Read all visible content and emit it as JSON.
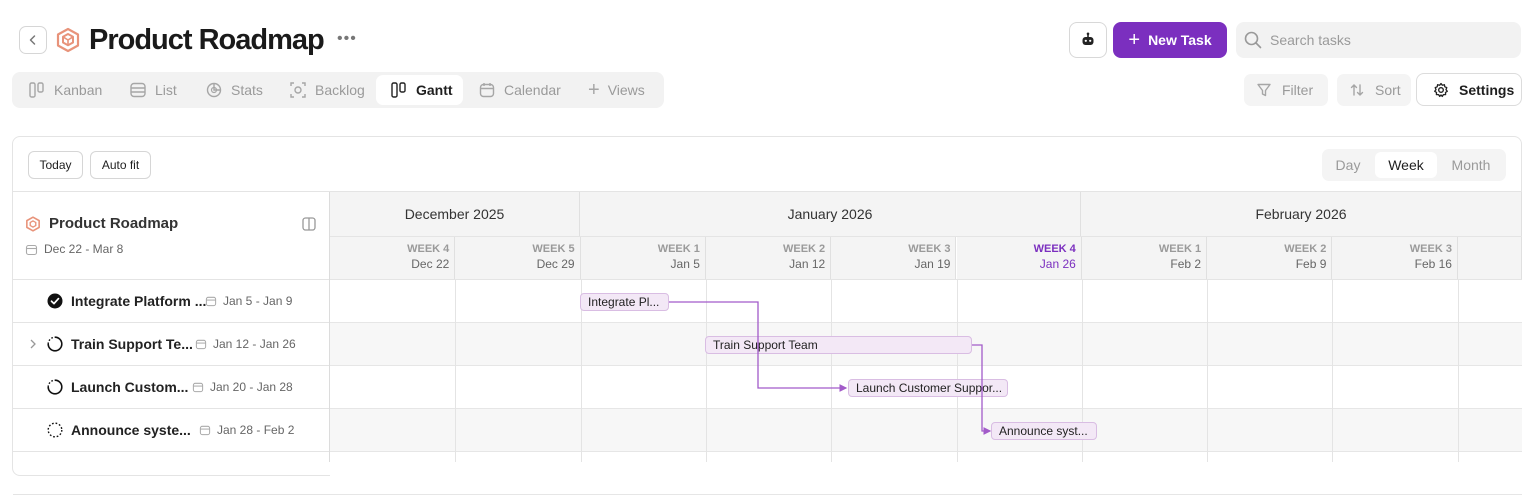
{
  "header": {
    "title": "Product Roadmap",
    "new_task_label": "New Task",
    "search_placeholder": "Search tasks",
    "accent": "#7b2fbf"
  },
  "tabs": [
    {
      "label": "Kanban",
      "icon": "kanban-icon"
    },
    {
      "label": "List",
      "icon": "list-icon"
    },
    {
      "label": "Stats",
      "icon": "stats-icon"
    },
    {
      "label": "Backlog",
      "icon": "backlog-icon"
    },
    {
      "label": "Gantt",
      "icon": "gantt-icon",
      "active": true
    },
    {
      "label": "Calendar",
      "icon": "calendar-icon"
    },
    {
      "label": "Views",
      "icon": "plus-icon"
    }
  ],
  "toolbar": {
    "filter_label": "Filter",
    "sort_label": "Sort",
    "settings_label": "Settings"
  },
  "gantt": {
    "today_label": "Today",
    "autofit_label": "Auto fit",
    "scale_options": [
      "Day",
      "Week",
      "Month"
    ],
    "scale_selected": "Week",
    "project_title": "Product Roadmap",
    "project_range": "Dec 22 - Mar 8",
    "months": [
      "December 2025",
      "January 2026",
      "February 2026"
    ],
    "weeks": [
      {
        "week": "WEEK 4",
        "date": "Dec 22"
      },
      {
        "week": "WEEK 5",
        "date": "Dec 29"
      },
      {
        "week": "WEEK 1",
        "date": "Jan 5"
      },
      {
        "week": "WEEK 2",
        "date": "Jan 12"
      },
      {
        "week": "WEEK 3",
        "date": "Jan 19"
      },
      {
        "week": "WEEK 4",
        "date": "Jan 26",
        "current": true
      },
      {
        "week": "WEEK 1",
        "date": "Feb 2"
      },
      {
        "week": "WEEK 2",
        "date": "Feb 9"
      },
      {
        "week": "WEEK 3",
        "date": "Feb 16"
      }
    ],
    "tasks": [
      {
        "name": "Integrate Platform ...",
        "dates": "Jan 5 - Jan 9",
        "status": "done",
        "bar_label": "Integrate Pl..."
      },
      {
        "name": "Train Support Te...",
        "dates": "Jan 12 - Jan 26",
        "status": "in-progress",
        "bar_label": "Train Support Team"
      },
      {
        "name": "Launch Custom...",
        "dates": "Jan 20 - Jan 28",
        "status": "in-progress",
        "bar_label": "Launch Customer Suppor..."
      },
      {
        "name": "Announce syste...",
        "dates": "Jan 28 - Feb 2",
        "status": "todo",
        "bar_label": "Announce syst..."
      }
    ]
  }
}
